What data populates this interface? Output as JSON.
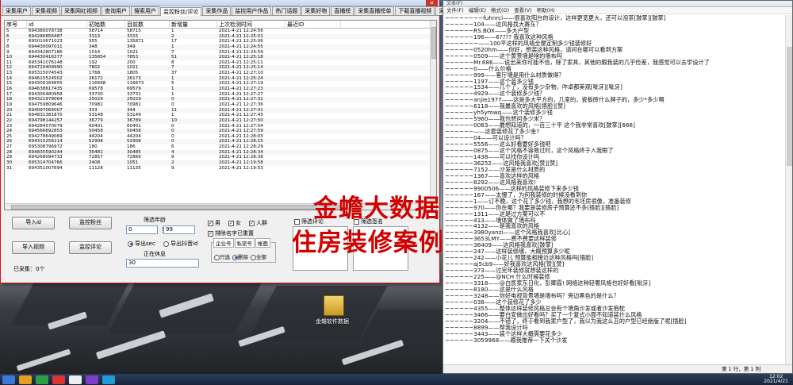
{
  "app": {
    "tabs": [
      "采集用户",
      "采集视频",
      "采集网红视频",
      "查询用户",
      "搜索用户",
      "监控粉丝/评论",
      "采集作品",
      "监控用户作品",
      "热门话题",
      "采集好物",
      "直播榜",
      "采集直播榜单",
      "下载直播视频",
      "采集直播间弹幕",
      "辅助功能"
    ],
    "active_tab_index": 5,
    "table": {
      "headers": [
        "序号",
        "id",
        "初始数",
        "目前数",
        "新增量",
        "上次检测时间",
        "最近ID"
      ],
      "rows": [
        [
          "5",
          "694380078738",
          "58714",
          "58715",
          "1",
          "2021-4-21 12:24:56",
          ""
        ],
        [
          "6",
          "694286856487",
          "3313",
          "3315",
          "2",
          "2021-4-21 12:25:01",
          ""
        ],
        [
          "7",
          "695010671023",
          "555",
          "135871",
          "17",
          "2021-4-21 12:25:06",
          ""
        ],
        [
          "8",
          "694430097011",
          "348",
          "349",
          "1",
          "2021-4-21 12:24:55",
          ""
        ],
        [
          "9",
          "694342807186",
          "1014",
          "1021",
          "7",
          "2021-4-21 12:24:59",
          ""
        ],
        [
          "10",
          "694430416377",
          "135854",
          "7853",
          "51",
          "2021-4-21 12:25:18",
          ""
        ],
        [
          "11",
          "695341076148",
          "192",
          "200",
          "8",
          "2021-4-21 12:25:11",
          ""
        ],
        [
          "12",
          "694720409990",
          "7802",
          "1021",
          "7",
          "2021-4-21 12:25:14",
          ""
        ],
        [
          "13",
          "695315074543",
          "1768",
          "1805",
          "37",
          "2021-4-21 12:27:10",
          ""
        ],
        [
          "14",
          "694615524502",
          "26172",
          "26173",
          "1",
          "2021-4-21 12:25:24",
          ""
        ],
        [
          "15",
          "694309164855",
          "116668",
          "116673",
          "5",
          "2021-4-21 12:27:19",
          ""
        ],
        [
          "16",
          "694638617435",
          "69578",
          "69579",
          "1",
          "2021-4-21 12:27:23",
          ""
        ],
        [
          "17",
          "694300480958",
          "33730",
          "33731",
          "1",
          "2021-4-21 12:27:27",
          ""
        ],
        [
          "18",
          "694321978064",
          "25029",
          "25029",
          "0",
          "2021-4-21 12:27:32",
          ""
        ],
        [
          "19",
          "694759809646",
          "70981",
          "70981",
          "0",
          "2021-4-21 12:27:36",
          ""
        ],
        [
          "20",
          "694097066007",
          "333",
          "344",
          "11",
          "2021-4-21 12:27:41",
          ""
        ],
        [
          "21",
          "694831381870",
          "53148",
          "53149",
          "1",
          "2021-4-21 12:27:45",
          ""
        ],
        [
          "22",
          "694798144257",
          "36779",
          "36789",
          "10",
          "2021-4-21 12:27:50",
          ""
        ],
        [
          "23",
          "694284570079",
          "60401",
          "60401",
          "0",
          "2021-4-21 12:27:54",
          ""
        ],
        [
          "24",
          "694566692853",
          "50458",
          "50458",
          "0",
          "2021-4-21 12:27:59",
          ""
        ],
        [
          "25",
          "694278649069",
          "44204",
          "44204",
          "0",
          "2021-4-21 12:28:03",
          ""
        ],
        [
          "26",
          "694315256214",
          "52908",
          "52908",
          "0",
          "2021-4-21 12:28:15",
          ""
        ],
        [
          "27",
          "695308796972",
          "180",
          "186",
          "6",
          "2021-4-21 12:28:29",
          ""
        ],
        [
          "28",
          "694835590244",
          "30481",
          "30485",
          "4",
          "2021-4-21 12:28:34",
          ""
        ],
        [
          "29",
          "694268094733",
          "72857",
          "72866",
          "9",
          "2021-4-21 12:28:38",
          ""
        ],
        [
          "30",
          "695314704766",
          "2408",
          "1051",
          "2",
          "2021-4-21 12:19:58",
          ""
        ],
        [
          "31",
          "694351007694",
          "11128",
          "11135",
          "9",
          "2021-4-21 12:19:53",
          ""
        ]
      ]
    },
    "buttons": {
      "import_id": "导入id",
      "monitor_fans": "监控粉丝",
      "import_video": "导入视频",
      "monitor_comments": "监控评论"
    },
    "filter": {
      "range_label": "筛选年龄",
      "from": "0",
      "to_label": "到",
      "to": "99",
      "export_sec": "导出sec",
      "export_id": "导出抖音id",
      "working_label": "正在休息",
      "working_value": "30"
    },
    "checks": {
      "male": "男",
      "female": "女",
      "people": "人群",
      "filter_comment": "筛选评论",
      "filter_sign": "筛选签名",
      "dedupe": "排除名字已重置"
    },
    "group": {
      "tabs": [
        "企业号",
        "私密号",
        "帐面"
      ],
      "options": [
        "只选",
        "删除",
        "全部"
      ]
    },
    "collected_label": "已采集：0个"
  },
  "watermark": {
    "line1": "金蟾大数据",
    "line2": "住房装修案例"
  },
  "desktop_icon_label": "金蟾软件数据",
  "notepad": {
    "title": "文本(F)",
    "menu": [
      "文件(F)",
      "编辑(E)",
      "格式(O)",
      "查看(V)",
      "帮助(H)"
    ],
    "status": "第 1 行，第 1 列",
    "lines": [
      "~~~~~~~~fuhnrcl——很喜欢阳台的设计，这样更宽更大，还可以泡茶[鼓掌][鼓掌]",
      "~~~~~~104——这风格找大赛东？",
      "~~~~~~RS.BOX——多大户型",
      "~~~~~~196——6???? 我喜欢这种风格",
      "~~~~~~~——100平这样的风格全屋定制多少钱装修好",
      "~~~~~~0520hm——你好，想装这种风格，请问在哪可以看到方案",
      "~~~~~~0509——这个黄景墙是啥的墙布吗",
      "~~~~~~Mr.686——说出来你可能不信，除了家具，其他的跟我装的几乎俭差，我感觉可以去学设计了",
      "~~~~~~0——什么价格",
      "~~~~~~999——客厅墙是用什么材质做得？",
      "~~~~~~1197——这个装多少钱",
      "~~~~~~1534——几个了，没有多少杂物，咋卓都美观[呲牙][呲牙]",
      "~~~~~~4929——这个装修多少钱？",
      "~~~~~~anjie1977——这是多大平方的，几室的，瓷板砖什么牌子的，多少*多少啊",
      "~~~~~~6118——我最喜欢的风格[捂脸][赞]",
      "~~~~~~yh5ymwq——这个装修多少钱",
      "~~~~~~5960——我也想问多少米？",
      "~~~~~~0083——最想知道的，一百三十平 这个我非常喜欢[鼓掌][666]",
      "~~~~~~——这套装修花了多少金?",
      "~~~~~~04——可以设计吗？",
      "~~~~~~5556——这么好看要好多钱吧",
      "~~~~~~0875——这个风格不容易过时，这个风格终于入我眼了",
      "~~~~~~1438——可以找你设计吗",
      "~~~~~~36252——这风格我喜欢[赞][赞]",
      "~~~~~~7152——沙发是什么材质的",
      "~~~~~~1367——喜欢这样的风格",
      "~~~~~~8292——这风格我喜欢!",
      "~~~~~~9900506——这样的风格装修下来多少钱",
      "~~~~~~167——太慢了，为何我装修的时候没看到你",
      "~~~~~~1——订不晚，这个花了多少钱，我想的毛坯房很像，准备装修",
      "~~~~~~970——你在哪？我要是装修房子预算还不多[捂脸][捂脸]",
      "~~~~~~1311——这是过方案可以不",
      "~~~~~~413——墙体做了墙布吗",
      "~~~~~~4132——是我喜欢的风格",
      "~~~~~~3980yanzi——这个风格我喜欢[比心]",
      "~~~~~~3653LMY——费不费要这样装修",
      "~~~~~~36409——这风格我喜欢[鼓掌]",
      "~~~~~~247——这样装修哪，大概预算多少呢",
      "~~~~~~242——小花儿 预算能相接近这种风格吗[捂脸]",
      "~~~~~~aj5cb9——好我喜欢这风格[赞][赞]",
      "~~~~~~373——过完年装修就想装这样的",
      "~~~~~~225——@NCH 什么时候装修",
      "~~~~~~3318——@白凯家东日化，彭卿霞! 网络这种轻奢风格也好好看[呲牙]",
      "~~~~~~8180——这是什么风格",
      "~~~~~~3248——你好电视背景墙是墙布吗？旁边黑色的是什么？",
      "~~~~~~038——这个装修花了多少",
      "~~~~~~4355——整体这样装修风格总会有个墙角沙发或者沙发抱枕",
      "~~~~~~3466——要白安做出好看吗？买了一个复式小面不知道装什么风格",
      "~~~~~~3204——不错了，终于看到我家户型了，我以为我这么丑的户型已经绝版了呢[捂脸]",
      "~~~~~~8899——帮我设计吗",
      "~~~~~~3443——装个这样大概需要花多少",
      "~~~~~~3059968——跟我推荐一下关个沙发"
    ]
  },
  "clock": {
    "time": "12:02",
    "date": "2021/4/21"
  }
}
